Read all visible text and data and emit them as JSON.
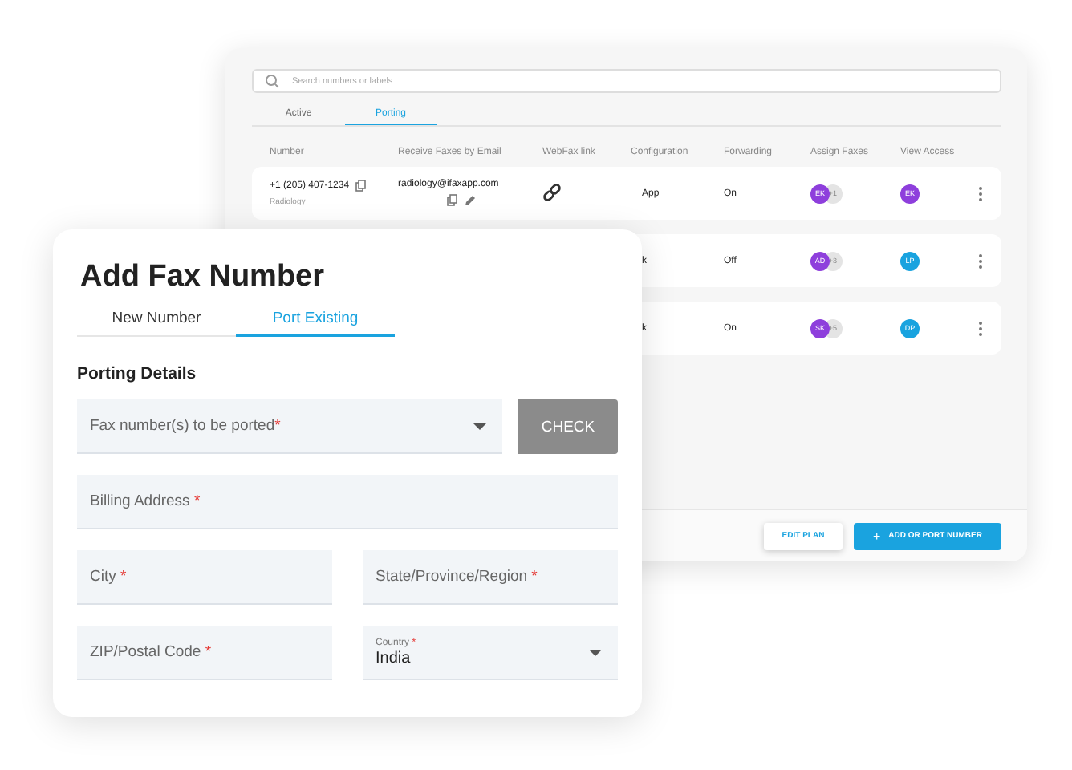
{
  "numbers_panel": {
    "search": {
      "placeholder": "Search numbers or labels"
    },
    "tabs": [
      {
        "label": "Active",
        "selected": false
      },
      {
        "label": "Porting",
        "selected": true
      }
    ],
    "columns": [
      "Number",
      "Receive Faxes by Email",
      "WebFax link",
      "Configuration",
      "Forwarding",
      "Assign Faxes",
      "View Access"
    ],
    "rows": [
      {
        "number": "+1 (205) 407-1234",
        "label": "Radiology",
        "email": "radiology@ifaxapp.com",
        "webfax_link": true,
        "configuration": "App",
        "forwarding": "On",
        "assign": {
          "initials": "EK",
          "color": "#8e3fdc",
          "extra": "+1"
        },
        "access": {
          "initials": "EK",
          "color": "#8e3fdc"
        }
      },
      {
        "configuration": "k",
        "forwarding": "Off",
        "assign": {
          "initials": "AD",
          "color": "#8e3fdc",
          "extra": "+3"
        },
        "access": {
          "initials": "LP",
          "color": "#19a3df"
        }
      },
      {
        "configuration": "k",
        "forwarding": "On",
        "assign": {
          "initials": "SK",
          "color": "#8e3fdc",
          "extra": "+5"
        },
        "access": {
          "initials": "DP",
          "color": "#19a3df"
        }
      }
    ],
    "buttons": [
      {
        "kind": "outline",
        "label": "EDIT PLAN"
      },
      {
        "kind": "primary",
        "icon": "+",
        "label": "ADD OR PORT NUMBER"
      }
    ]
  },
  "dialog": {
    "title": "Add Fax Number",
    "tabs": [
      {
        "label": "New Number",
        "selected": false
      },
      {
        "label": "Port Existing",
        "selected": true
      }
    ],
    "section": "Porting Details",
    "field_rows": [
      [
        {
          "kind": "dropdown",
          "placeholder": "Fax number(s) to be ported",
          "required_mark": "*",
          "button": "CHECK"
        }
      ],
      [
        {
          "kind": "text",
          "placeholder": "Billing Address",
          "required_mark": "*"
        }
      ],
      [
        {
          "kind": "text",
          "placeholder": "City",
          "required_mark": "*"
        },
        {
          "kind": "text",
          "placeholder": "State/Province/Region",
          "required_mark": "*"
        }
      ],
      [
        {
          "kind": "text",
          "placeholder": "ZIP/Postal Code",
          "required_mark": "*"
        },
        {
          "kind": "select",
          "label": "Country",
          "required_mark": "*",
          "value": "India"
        }
      ]
    ]
  }
}
